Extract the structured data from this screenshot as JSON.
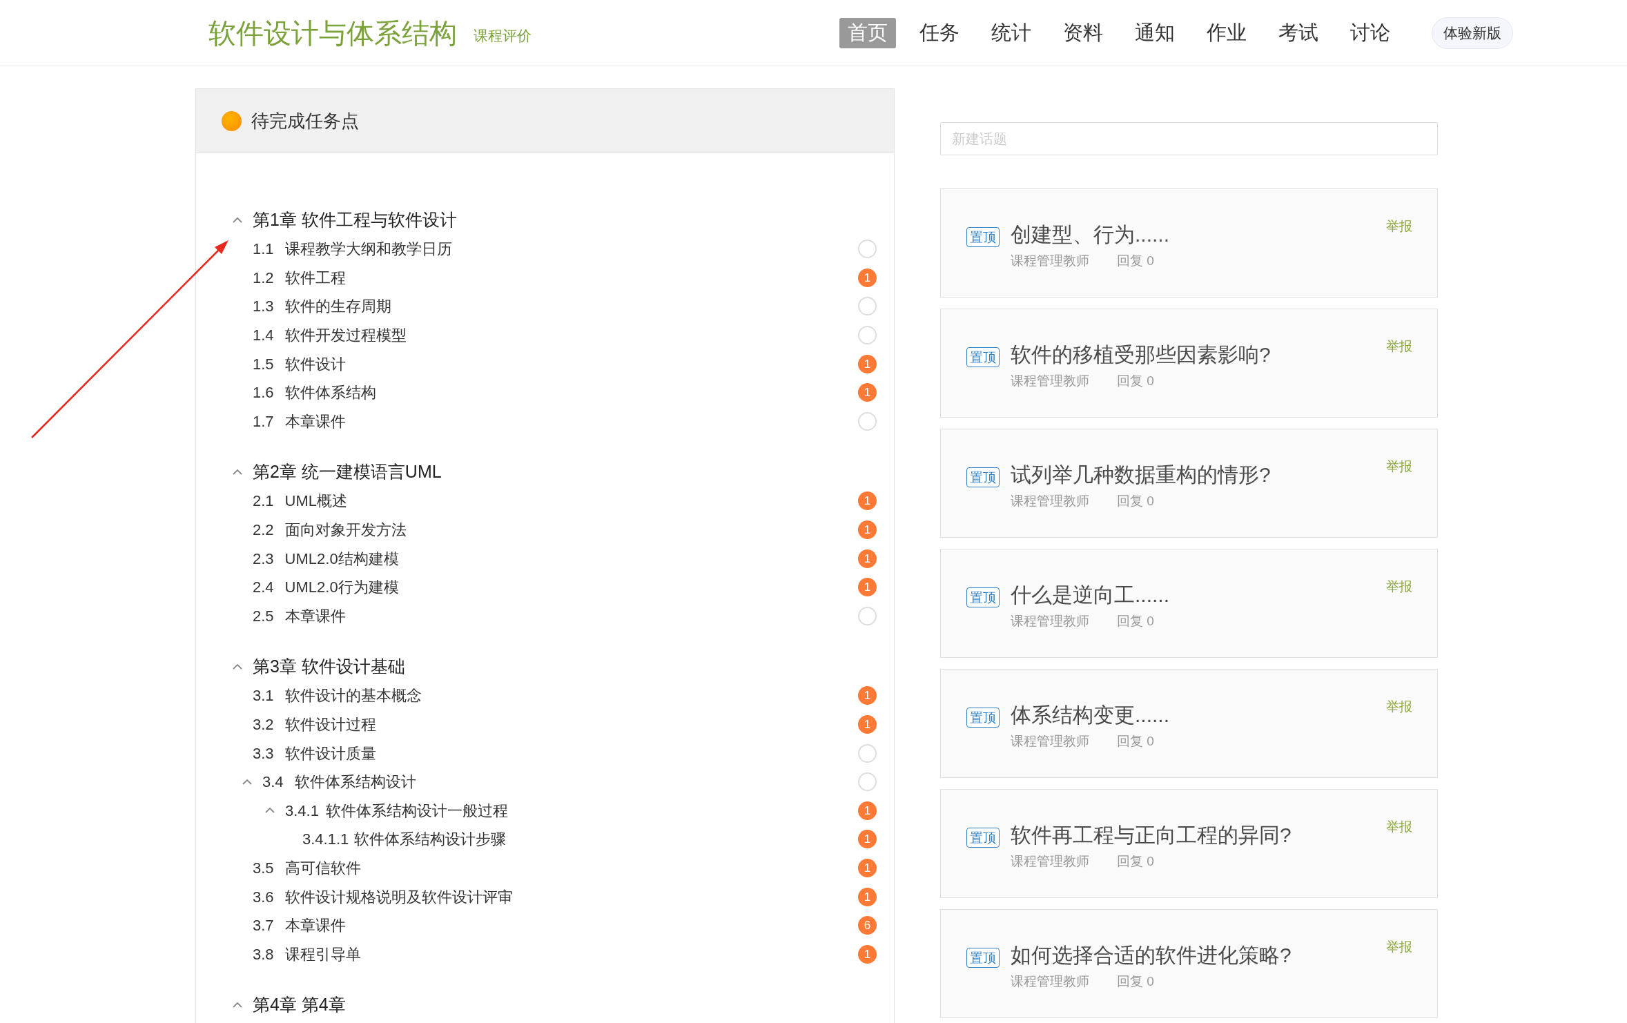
{
  "header": {
    "title": "软件设计与体系结构",
    "subtitle": "课程评价",
    "nav": [
      {
        "label": "首页",
        "selected": true
      },
      {
        "label": "任务",
        "selected": false
      },
      {
        "label": "统计",
        "selected": false
      },
      {
        "label": "资料",
        "selected": false
      },
      {
        "label": "通知",
        "selected": false
      },
      {
        "label": "作业",
        "selected": false
      },
      {
        "label": "考试",
        "selected": false
      },
      {
        "label": "讨论",
        "selected": false
      }
    ],
    "new_version_button": "体验新版"
  },
  "tasks": {
    "title": "待完成任务点",
    "chapters": [
      {
        "title": "第1章 软件工程与软件设计",
        "expanded": true,
        "items": [
          {
            "number": "1.1",
            "title": "课程教学大纲和教学日历"
          },
          {
            "number": "1.2",
            "title": "软件工程",
            "count": "1"
          },
          {
            "number": "1.3",
            "title": "软件的生存周期"
          },
          {
            "number": "1.4",
            "title": "软件开发过程模型"
          },
          {
            "number": "1.5",
            "title": "软件设计",
            "count": "1"
          },
          {
            "number": "1.6",
            "title": "软件体系结构",
            "count": "1"
          },
          {
            "number": "1.7",
            "title": "本章课件"
          }
        ]
      },
      {
        "title": "第2章 统一建模语言UML",
        "expanded": true,
        "items": [
          {
            "number": "2.1",
            "title": "UML概述",
            "count": "1"
          },
          {
            "number": "2.2",
            "title": "面向对象开发方法",
            "count": "1"
          },
          {
            "number": "2.3",
            "title": "UML2.0结构建模",
            "count": "1"
          },
          {
            "number": "2.4",
            "title": "UML2.0行为建模",
            "count": "1"
          },
          {
            "number": "2.5",
            "title": "本章课件"
          }
        ]
      },
      {
        "title": "第3章 软件设计基础",
        "expanded": true,
        "items": [
          {
            "number": "3.1",
            "title": "软件设计的基本概念",
            "count": "1"
          },
          {
            "number": "3.2",
            "title": "软件设计过程",
            "count": "1"
          },
          {
            "number": "3.3",
            "title": "软件设计质量"
          },
          {
            "number": "3.4",
            "title": "软件体系结构设计",
            "expanded": true,
            "children": [
              {
                "number": "3.4.1",
                "title": "软件体系结构设计一般过程",
                "count": "1",
                "expanded": true,
                "children": [
                  {
                    "number": "3.4.1.1",
                    "title": "软件体系结构设计步骤",
                    "count": "1"
                  }
                ]
              }
            ]
          },
          {
            "number": "3.5",
            "title": "高可信软件",
            "count": "1"
          },
          {
            "number": "3.6",
            "title": "软件设计规格说明及软件设计评审",
            "count": "1"
          },
          {
            "number": "3.7",
            "title": "本章课件",
            "count": "6"
          },
          {
            "number": "3.8",
            "title": "课程引导单",
            "count": "1"
          }
        ]
      },
      {
        "title": "第4章 第4章",
        "expanded": true
      }
    ]
  },
  "discussion": {
    "new_topic_placeholder": "新建话题",
    "topics": [
      {
        "tag": "置顶",
        "title": "创建型、行为......",
        "author": "课程管理教师",
        "replies": "回复 0",
        "report": "举报"
      },
      {
        "tag": "置顶",
        "title": "软件的移植受那些因素影响?",
        "author": "课程管理教师",
        "replies": "回复 0",
        "report": "举报"
      },
      {
        "tag": "置顶",
        "title": "试列举几种数据重构的情形?",
        "author": "课程管理教师",
        "replies": "回复 0",
        "report": "举报"
      },
      {
        "tag": "置顶",
        "title": "什么是逆向工......",
        "author": "课程管理教师",
        "replies": "回复 0",
        "report": "举报"
      },
      {
        "tag": "置顶",
        "title": "体系结构变更......",
        "author": "课程管理教师",
        "replies": "回复 0",
        "report": "举报"
      },
      {
        "tag": "置顶",
        "title": "软件再工程与正向工程的异同?",
        "author": "课程管理教师",
        "replies": "回复 0",
        "report": "举报"
      },
      {
        "tag": "置顶",
        "title": "如何选择合适的软件进化策略?",
        "author": "课程管理教师",
        "replies": "回复 0",
        "report": "举报"
      }
    ]
  }
}
